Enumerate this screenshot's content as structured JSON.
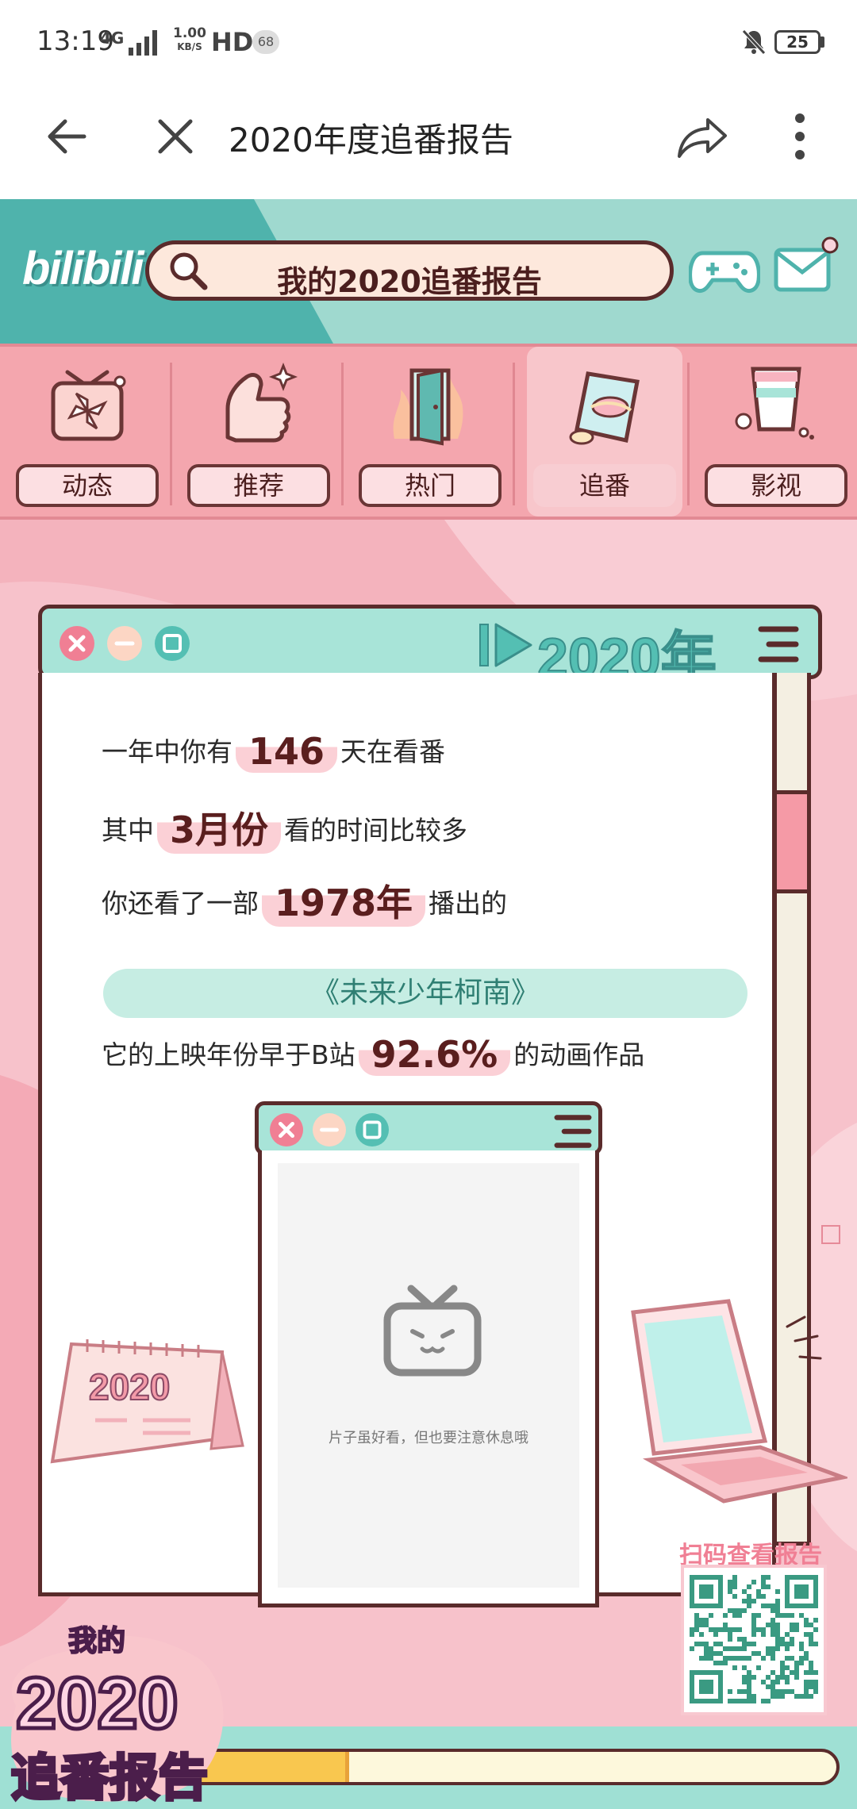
{
  "status_bar": {
    "time": "13:19",
    "network": "4G",
    "speed": "1.00",
    "speed_unit": "KB/S",
    "hd": "HD",
    "notification_count": "68",
    "battery": "25"
  },
  "title_bar": {
    "title": "2020年度追番报告",
    "icons": [
      "back-arrow-icon",
      "close-icon",
      "share-icon",
      "more-vertical-icon"
    ]
  },
  "hero": {
    "logo": "bilibili",
    "search_text": "我的2020追番报告",
    "icons": [
      "search-icon",
      "gamepad-icon",
      "mail-icon"
    ]
  },
  "nav": {
    "items": [
      {
        "label": "动态",
        "active": false
      },
      {
        "label": "推荐",
        "active": false
      },
      {
        "label": "热门",
        "active": false
      },
      {
        "label": "追番",
        "active": true
      },
      {
        "label": "影视",
        "active": false
      }
    ]
  },
  "report": {
    "year": "2020年",
    "line1": {
      "pre": "一年中你有",
      "value": "146",
      "post": "天在看番"
    },
    "line2": {
      "pre": "其中",
      "value": "3月份",
      "post": "看的时间比较多"
    },
    "line3": {
      "pre": "你还看了一部",
      "value": "1978年",
      "post": "播出的"
    },
    "anime_title": "《未来少年柯南》",
    "line4": {
      "pre": "它的上映年份早于B站",
      "value": "92.6%",
      "post": "的动画作品"
    }
  },
  "player": {
    "caption": "片子虽好看，但也要注意休息哦"
  },
  "decor": {
    "calendar_text": "2020",
    "badge_text": [
      "我的",
      "2020",
      "追番报告"
    ]
  },
  "qr": {
    "label": "扫码查看报告"
  },
  "progress": {
    "fraction": 0.29
  },
  "colors": {
    "teal": "#a8e4d8",
    "pink": "#f4a6ae",
    "dark": "#5a2b2b",
    "highlight": "#fbd0d6"
  }
}
